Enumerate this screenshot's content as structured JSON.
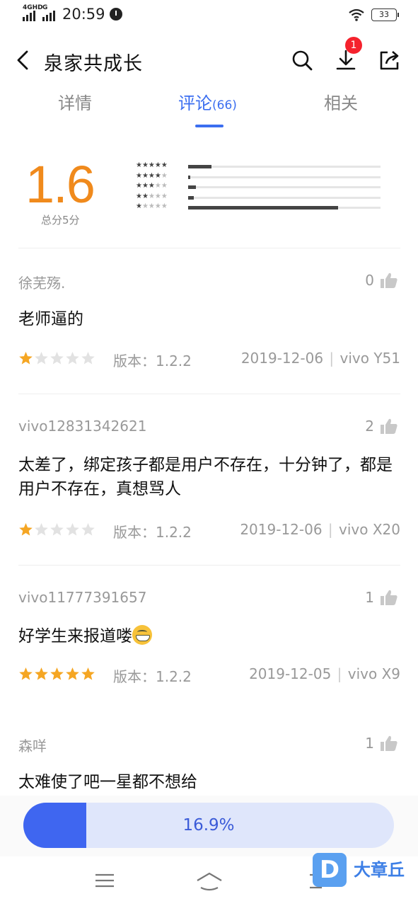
{
  "status": {
    "net1": "4GHD",
    "net2": "G",
    "time": "20:59",
    "battery": "33"
  },
  "header": {
    "title": "泉家共成长",
    "download_badge": "1"
  },
  "tabs": [
    {
      "label": "详情",
      "count": ""
    },
    {
      "label": "评论",
      "count": "(66)"
    },
    {
      "label": "相关",
      "count": ""
    }
  ],
  "rating": {
    "score": "1.6",
    "subtitle": "总分5分",
    "distribution": [
      {
        "stars": 5,
        "fraction": 0.12
      },
      {
        "stars": 4,
        "fraction": 0.01
      },
      {
        "stars": 3,
        "fraction": 0.04
      },
      {
        "stars": 2,
        "fraction": 0.03
      },
      {
        "stars": 1,
        "fraction": 0.78
      }
    ]
  },
  "reviews": [
    {
      "user": "徐芜殇.",
      "likes": "0",
      "text": "老师逼的",
      "stars": 1,
      "version": "版本：1.2.2",
      "date": "2019-12-06",
      "device": "vivo Y51"
    },
    {
      "user": "vivo12831342621",
      "likes": "2",
      "text": "太差了，绑定孩子都是用户不存在，十分钟了，都是用户不存在，真想骂人",
      "stars": 1,
      "version": "版本：1.2.2",
      "date": "2019-12-06",
      "device": "vivo X20"
    },
    {
      "user": "vivo11777391657",
      "likes": "1",
      "text": "好学生来报道喽",
      "emoji": "grinning-face-emoji",
      "stars": 5,
      "version": "版本：1.2.2",
      "date": "2019-12-05",
      "device": "vivo X9"
    },
    {
      "user": "森咩",
      "likes": "1",
      "text": "太难使了吧一星都不想给"
    }
  ],
  "download": {
    "progress_label": "16.9%",
    "progress": 0.169
  },
  "watermark": {
    "logo_letter": "D",
    "text": "大章丘"
  },
  "colors": {
    "accent": "#3b6ef0",
    "score": "#f08a1c",
    "star": "#f5a623",
    "badge": "#f5222d"
  }
}
